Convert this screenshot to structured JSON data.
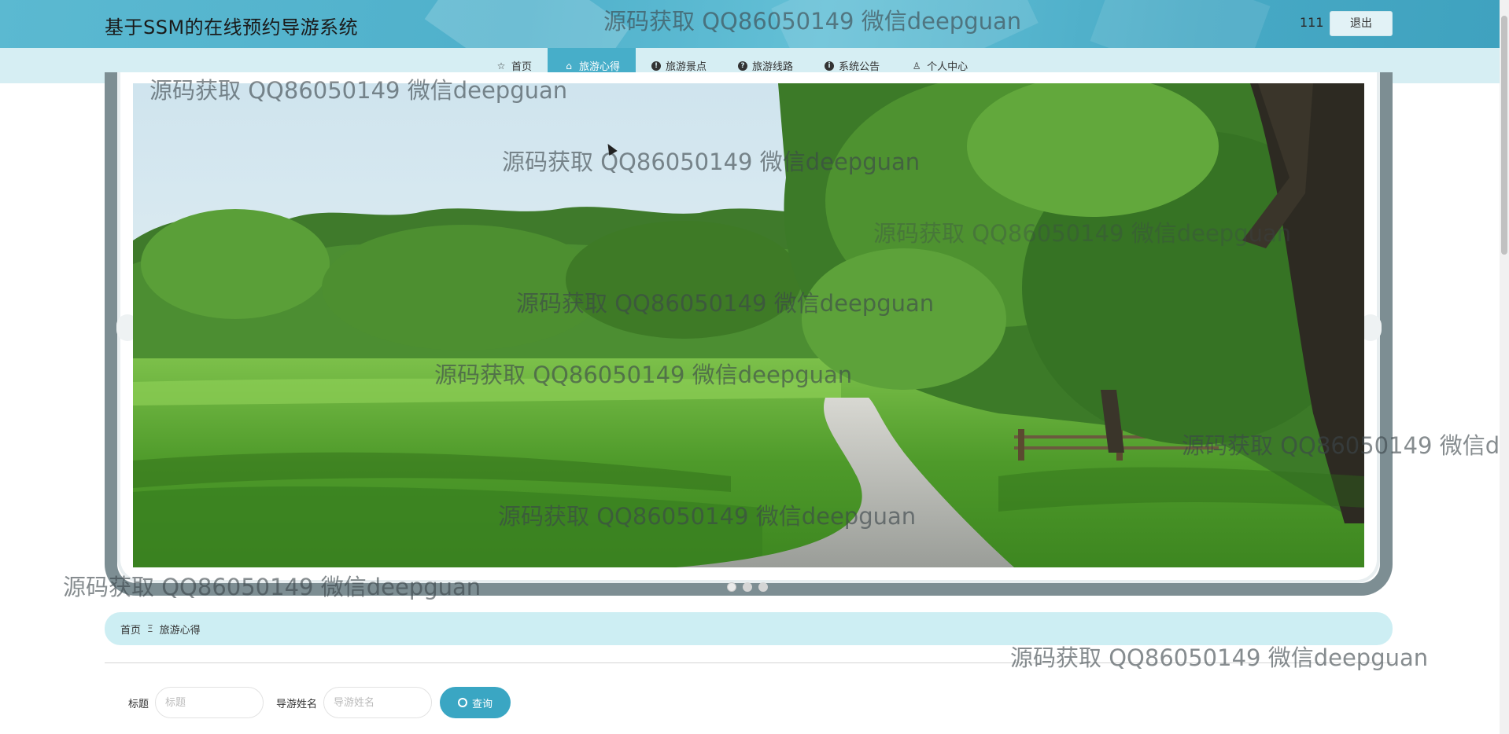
{
  "header": {
    "title": "基于SSM的在线预约导游系统",
    "user": "111",
    "logout_label": "退出"
  },
  "nav": {
    "items": [
      {
        "label": "首页",
        "icon": "star-icon",
        "active": false
      },
      {
        "label": "旅游心得",
        "icon": "bag-icon",
        "active": true
      },
      {
        "label": "旅游景点",
        "icon": "info-circle-icon",
        "active": false
      },
      {
        "label": "旅游线路",
        "icon": "question-circle-icon",
        "active": false
      },
      {
        "label": "系统公告",
        "icon": "info-circle-icon",
        "active": false
      },
      {
        "label": "个人中心",
        "icon": "user-icon",
        "active": false
      }
    ]
  },
  "carousel": {
    "slides": 3,
    "active_index": 0
  },
  "breadcrumb": {
    "home": "首页",
    "separator": "Ξ",
    "current": "旅游心得"
  },
  "search": {
    "title_label": "标题",
    "title_placeholder": "标题",
    "guide_label": "导游姓名",
    "guide_placeholder": "导游姓名",
    "button_label": "查询"
  },
  "watermark": {
    "text": "源码获取 QQ86050149 微信deepguan"
  },
  "colors": {
    "header_bg": "#4fb0cb",
    "nav_bg": "#d6eef3",
    "nav_active": "#47aec9",
    "breadcrumb_bg": "#cdeef3",
    "button_bg": "#3aa6c3",
    "frame": "#7d8e93"
  }
}
